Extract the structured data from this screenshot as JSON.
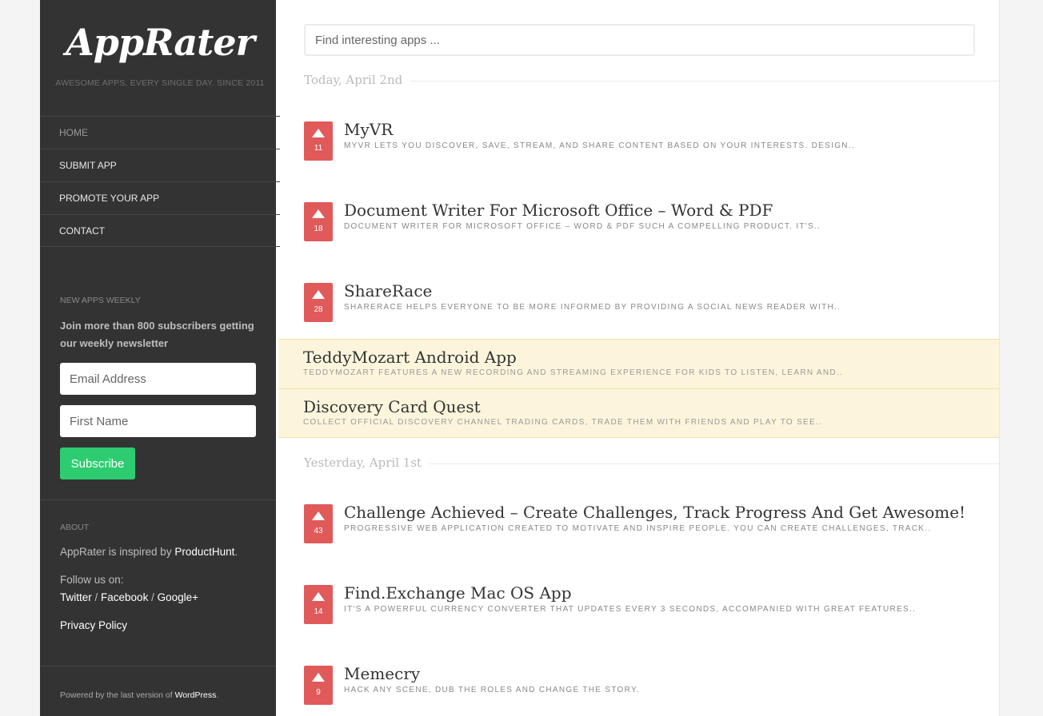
{
  "brand": {
    "logo": "AppRater",
    "tagline": "AWESOME APPS, EVERY SINGLE DAY. SINCE 2011"
  },
  "nav": {
    "items": [
      {
        "label": "HOME"
      },
      {
        "label": "SUBMIT APP"
      },
      {
        "label": "PROMOTE YOUR APP"
      },
      {
        "label": "CONTACT"
      }
    ]
  },
  "newsletter": {
    "title": "NEW APPS WEEKLY",
    "text": "Join more than 800 subscribers getting our weekly newsletter",
    "email_placeholder": "Email Address",
    "name_placeholder": "First Name",
    "subscribe_label": "Subscribe"
  },
  "about": {
    "title": "ABOUT",
    "inspired_prefix": "AppRater is inspired by ",
    "inspired_link": "ProductHunt",
    "inspired_suffix": ".",
    "follow_label": "Follow us on:",
    "twitter": "Twitter",
    "facebook": "Facebook",
    "googleplus": "Google+",
    "sep": " / ",
    "privacy": "Privacy Policy"
  },
  "footer": {
    "prefix": "Powered by the last version of ",
    "link": "WordPress",
    "suffix": "."
  },
  "search": {
    "placeholder": "Find interesting apps ..."
  },
  "days": [
    {
      "label": "Today, April 2nd",
      "apps": [
        {
          "votes": "11",
          "title": "MyVR",
          "desc": "MyVR lets you discover, save, stream, and share content based on your interests. Design.."
        },
        {
          "votes": "18",
          "title": "Document Writer For Microsoft Office – Word & PDF",
          "desc": "Document Writer for Microsoft Office – Word & PDF such a compelling product. It's.."
        },
        {
          "votes": "28",
          "title": "ShareRace",
          "desc": "ShareRace helps everyone to be more informed by providing a social news reader with.."
        }
      ],
      "promoted": [
        {
          "title": "TeddyMozart Android App",
          "desc": "TeddyMozart features a new recording and streaming experience for kids to listen, learn and.."
        },
        {
          "title": "Discovery Card Quest",
          "desc": "Collect official Discovery Channel trading cards, trade them with friends and play to see.."
        }
      ]
    },
    {
      "label": "Yesterday, April 1st",
      "apps": [
        {
          "votes": "43",
          "title": "Challenge Achieved – Create Challenges, Track Progress And Get Awesome!",
          "desc": "Progressive web application created to motivate and inspire people. You can create challenges, track.."
        },
        {
          "votes": "14",
          "title": "Find.Exchange Mac OS App",
          "desc": "It's a powerful currency converter that updates every 3 seconds, accompanied with great features.."
        },
        {
          "votes": "9",
          "title": "Memecry",
          "desc": "Hack any scene, dub the roles and change the story."
        }
      ]
    }
  ]
}
